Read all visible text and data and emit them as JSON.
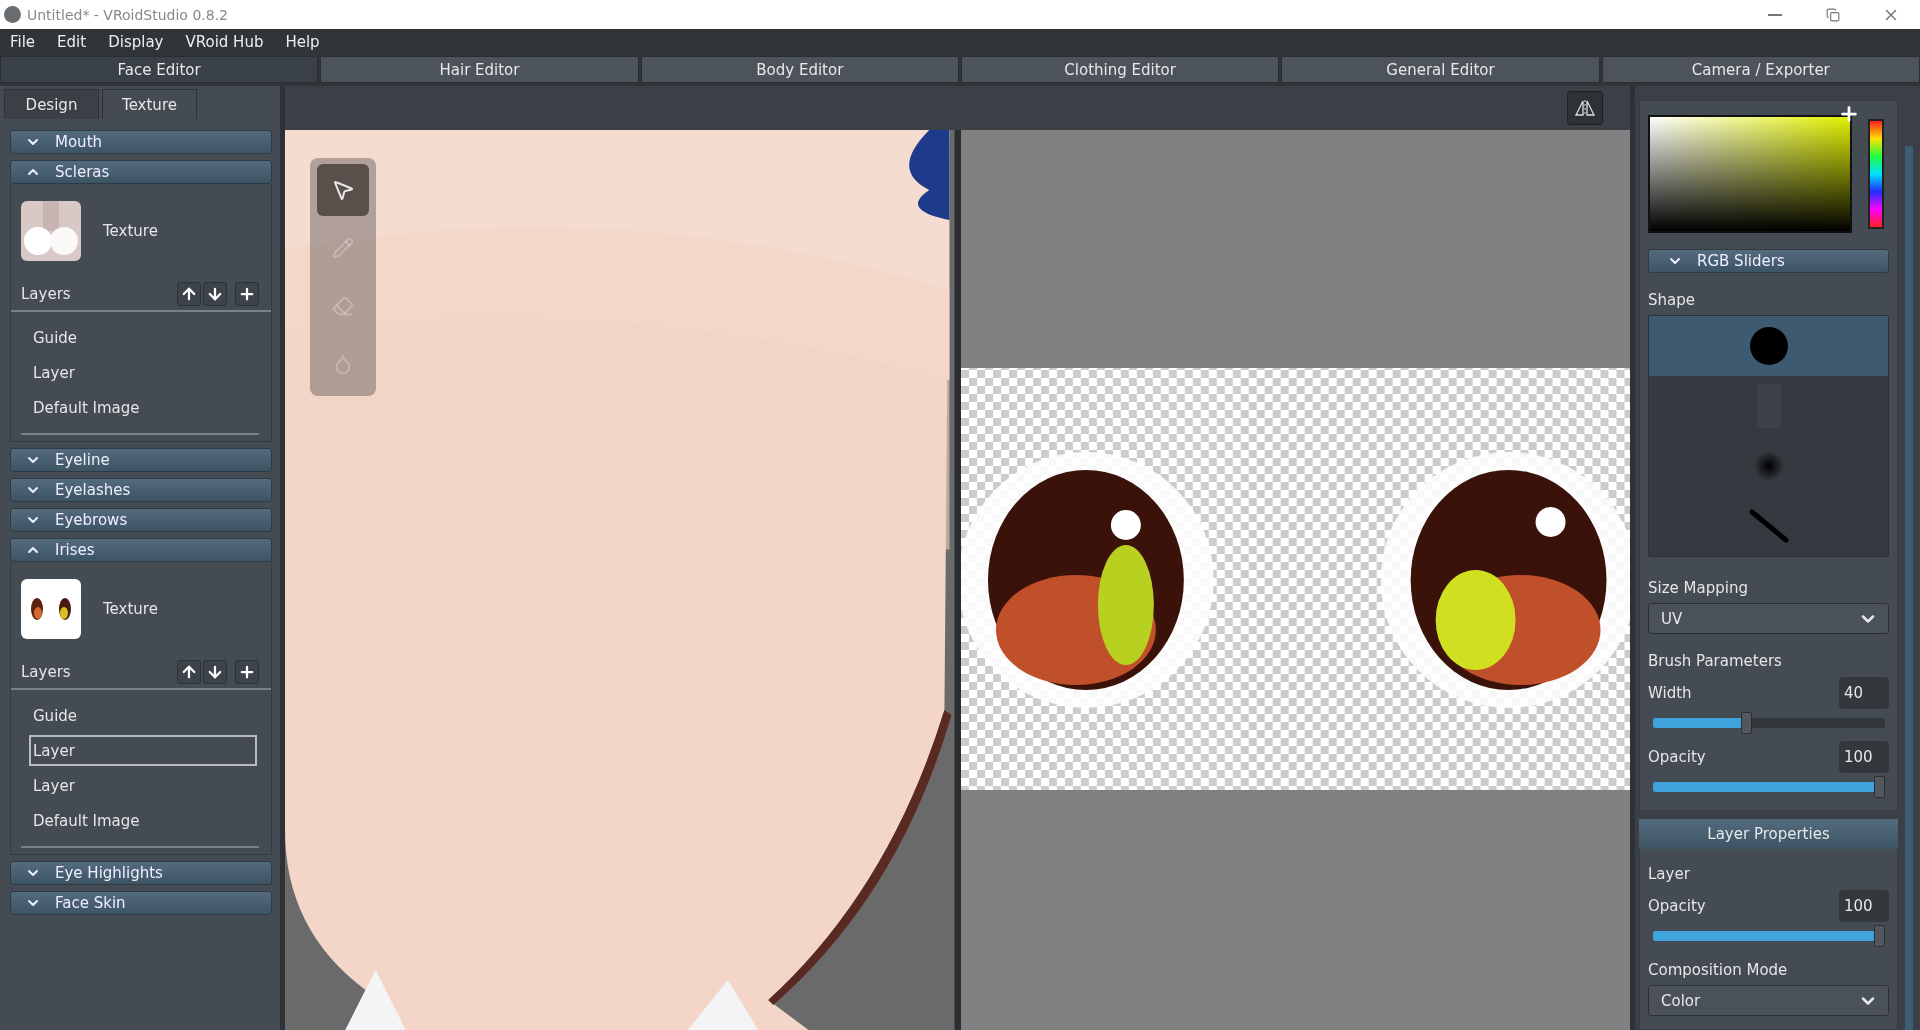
{
  "window": {
    "title": "Untitled* - VRoidStudio 0.8.2"
  },
  "menu": [
    "File",
    "Edit",
    "Display",
    "VRoid Hub",
    "Help"
  ],
  "editor_tabs": [
    {
      "label": "Face Editor",
      "selected": true
    },
    {
      "label": "Hair Editor",
      "selected": false
    },
    {
      "label": "Body Editor",
      "selected": false
    },
    {
      "label": "Clothing Editor",
      "selected": false
    },
    {
      "label": "General Editor",
      "selected": false
    },
    {
      "label": "Camera / Exporter",
      "selected": false
    }
  ],
  "panel_tabs": [
    {
      "label": "Design",
      "selected": false
    },
    {
      "label": "Texture",
      "selected": true
    }
  ],
  "sections": [
    {
      "title": "Mouth",
      "expanded": false
    },
    {
      "title": "Scleras",
      "expanded": true,
      "thumbnail": {
        "kind": "picture"
      },
      "texture_label": "Texture",
      "layers_label": "Layers",
      "layers": [
        {
          "label": "Guide",
          "selected": false
        },
        {
          "label": "Layer",
          "selected": false
        },
        {
          "label": "Default Image",
          "selected": false
        }
      ]
    },
    {
      "title": "Eyeline",
      "expanded": false
    },
    {
      "title": "Eyelashes",
      "expanded": false
    },
    {
      "title": "Eyebrows",
      "expanded": false
    },
    {
      "title": "Irises",
      "expanded": true,
      "thumbnail": {
        "kind": "picture"
      },
      "texture_label": "Texture",
      "layers_label": "Layers",
      "layers": [
        {
          "label": "Guide",
          "selected": false
        },
        {
          "label": "Layer",
          "selected": true
        },
        {
          "label": "Layer",
          "selected": false
        },
        {
          "label": "Default Image",
          "selected": false
        }
      ]
    },
    {
      "title": "Eye Highlights",
      "expanded": false
    },
    {
      "title": "Face Skin",
      "expanded": false
    }
  ],
  "tools": [
    {
      "kind": "select",
      "selected": true
    },
    {
      "kind": "pen",
      "selected": false
    },
    {
      "kind": "eraser",
      "selected": false
    },
    {
      "kind": "fill",
      "selected": false
    }
  ],
  "brush_panel": {
    "rgb_sliders": {
      "title": "RGB Sliders",
      "expanded": false
    },
    "shape_label": "Shape",
    "shapes": [
      {
        "kind": "hard",
        "selected": true
      },
      {
        "kind": "texture",
        "selected": false
      },
      {
        "kind": "soft",
        "selected": false
      },
      {
        "kind": "line",
        "selected": false
      }
    ],
    "size_mapping": {
      "label": "Size Mapping",
      "value": "UV"
    },
    "parameters_label": "Brush Parameters",
    "sliders": [
      {
        "label": "Width",
        "reading": "40",
        "level": 0.4
      },
      {
        "label": "Opacity",
        "reading": "100",
        "level": 1
      }
    ]
  },
  "layer_properties": {
    "title": "Layer Properties",
    "layer_label": "Layer",
    "sliders": [
      {
        "label": "Opacity",
        "reading": "100",
        "level": 1
      }
    ],
    "composition_mode": {
      "label": "Composition Mode",
      "value": "Color"
    }
  }
}
